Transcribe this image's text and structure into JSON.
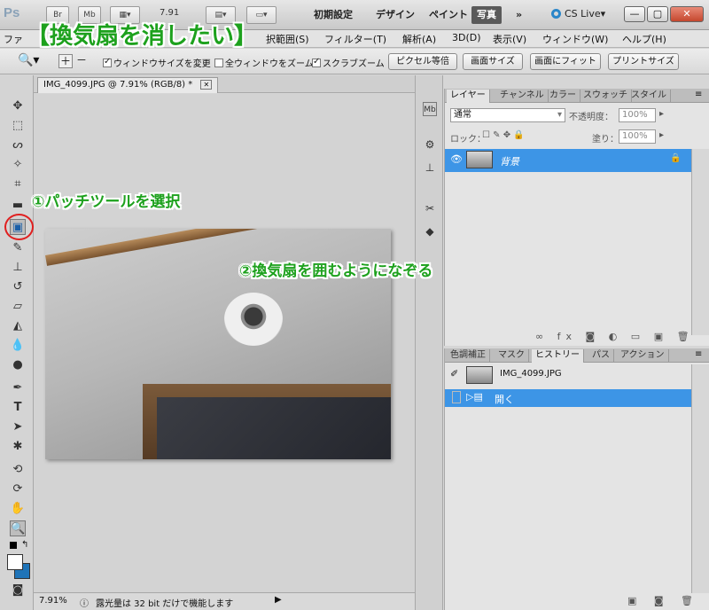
{
  "appbar": {
    "logo": "Ps",
    "br_button": "Br",
    "mb_button": "Mb",
    "zoom_value": "7.91",
    "workspaces": [
      "初期設定",
      "デザイン",
      "ペイント",
      "写真"
    ],
    "active_workspace": "写真",
    "more": "»",
    "cs_live": "CS Live▾",
    "window_buttons": [
      "—",
      "▢",
      "✕"
    ]
  },
  "menubar": {
    "items": [
      "ファ",
      "択範囲(S)",
      "フィルター(T)",
      "解析(A)",
      "3D(D)",
      "表示(V)",
      "ウィンドウ(W)",
      "ヘルプ(H)"
    ]
  },
  "optionsbar": {
    "checkboxes": [
      {
        "label": "ウィンドウサイズを変更",
        "checked": true
      },
      {
        "label": "全ウィンドウをズーム",
        "checked": false
      },
      {
        "label": "スクラブズーム",
        "checked": true
      }
    ],
    "buttons": [
      "ピクセル等倍",
      "画面サイズ",
      "画面にフィット",
      "プリントサイズ"
    ]
  },
  "document": {
    "tab_title": "IMG_4099.JPG @ 7.91% (RGB/8) *",
    "close": "✕",
    "status_zoom": "7.91%",
    "status_message": "露光量は 32 bit だけで機能します"
  },
  "layers_panel": {
    "tabs": [
      "レイヤー",
      "チャンネル",
      "カラー",
      "スウォッチ",
      "スタイル"
    ],
    "blend_mode": "通常",
    "opacity_label": "不透明度：",
    "opacity_value": "100%",
    "lock_label": "ロック：",
    "fill_label": "塗り：",
    "fill_value": "100%",
    "layer_name": "背景"
  },
  "history_panel": {
    "tabs": [
      "色調補正",
      "マスク",
      "ヒストリー",
      "パス",
      "アクション"
    ],
    "snapshot_name": "IMG_4099.JPG",
    "state_name": "開く"
  },
  "annotations": {
    "title": "【換気扇を消したい】",
    "step1": "①パッチツールを選択",
    "step2": "②換気扇を囲むようになぞる"
  },
  "colors": {
    "annotation_green": "#1da11d",
    "selection_blue": "#3d95e6",
    "highlight_red": "#e02020"
  }
}
